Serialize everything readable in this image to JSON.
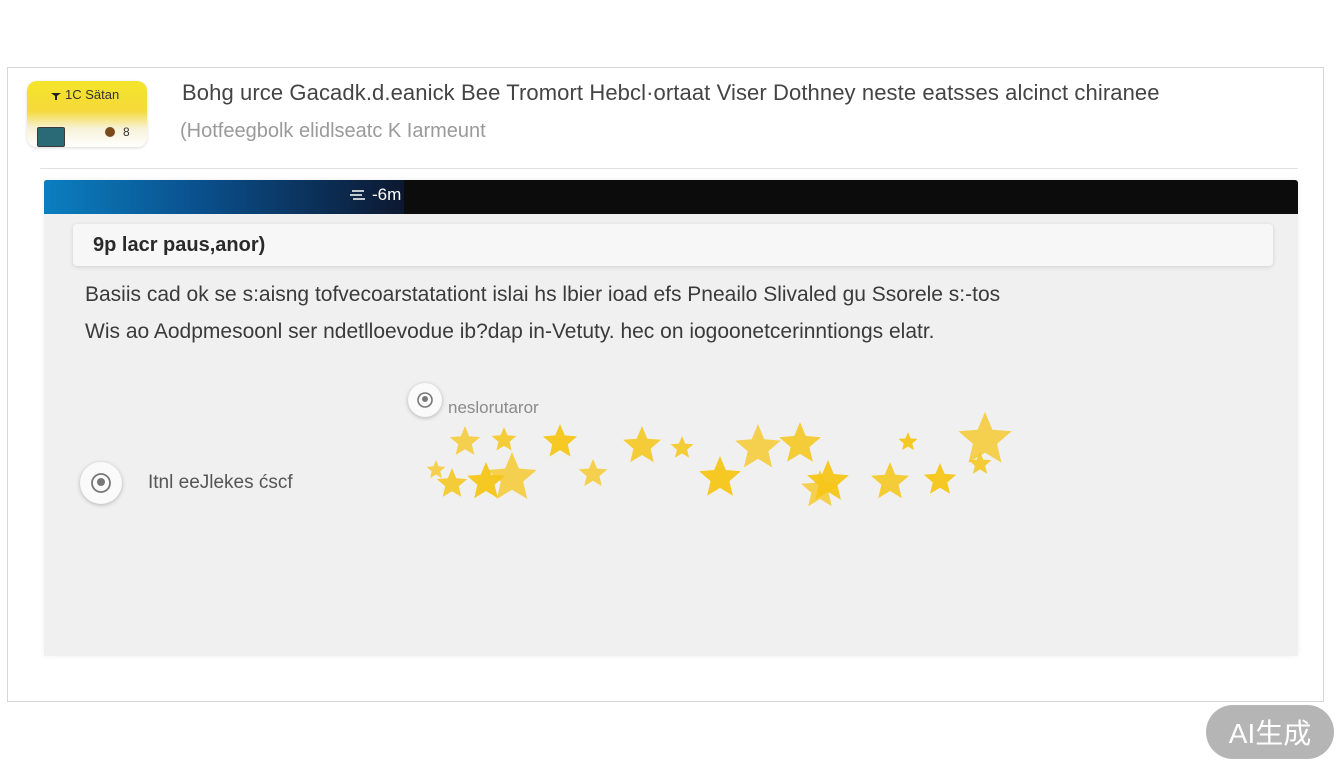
{
  "header": {
    "brand": "1C Sätan",
    "count": "8",
    "title": "Bohg urce Gacadk.d.eanick Bee Tromort Hebcl·ortaat Viser Dothney neste eatsses alcinct chiranee",
    "subtitle": "(Hotfeegbolk elidlseatc K Iarmeunt"
  },
  "progress": {
    "label": "-6m",
    "fraction": 0.287
  },
  "search": {
    "value": "9p lacr paus,anor)"
  },
  "description": {
    "line1": "Basiis cad ok se s:aisng tofvecoarstatationt islai hs lbier ioad  efs Pneailo Slivaled gu Ssorele s:-tos",
    "line2": "Wis ao Aodpmesoonl ser ndetlloevodue ib?dap  in-Vetuty. hec on iogoonetcerinntiongs  elatr."
  },
  "reviewer": {
    "name": "neslorutaror",
    "icon": "user-avatar-icon"
  },
  "feedback": {
    "label": "Itnl eeJlekes ćscf",
    "icon": "user-avatar-icon"
  },
  "rating": {
    "star_count": 20,
    "star_color": "#f5c518"
  },
  "badge": {
    "label": "AI生成"
  },
  "colors": {
    "brand_yellow": "#f3e52a",
    "progress_blue": "#0a7fc0",
    "progress_track": "#0c0c0c",
    "panel_bg": "#f0f0f0"
  }
}
